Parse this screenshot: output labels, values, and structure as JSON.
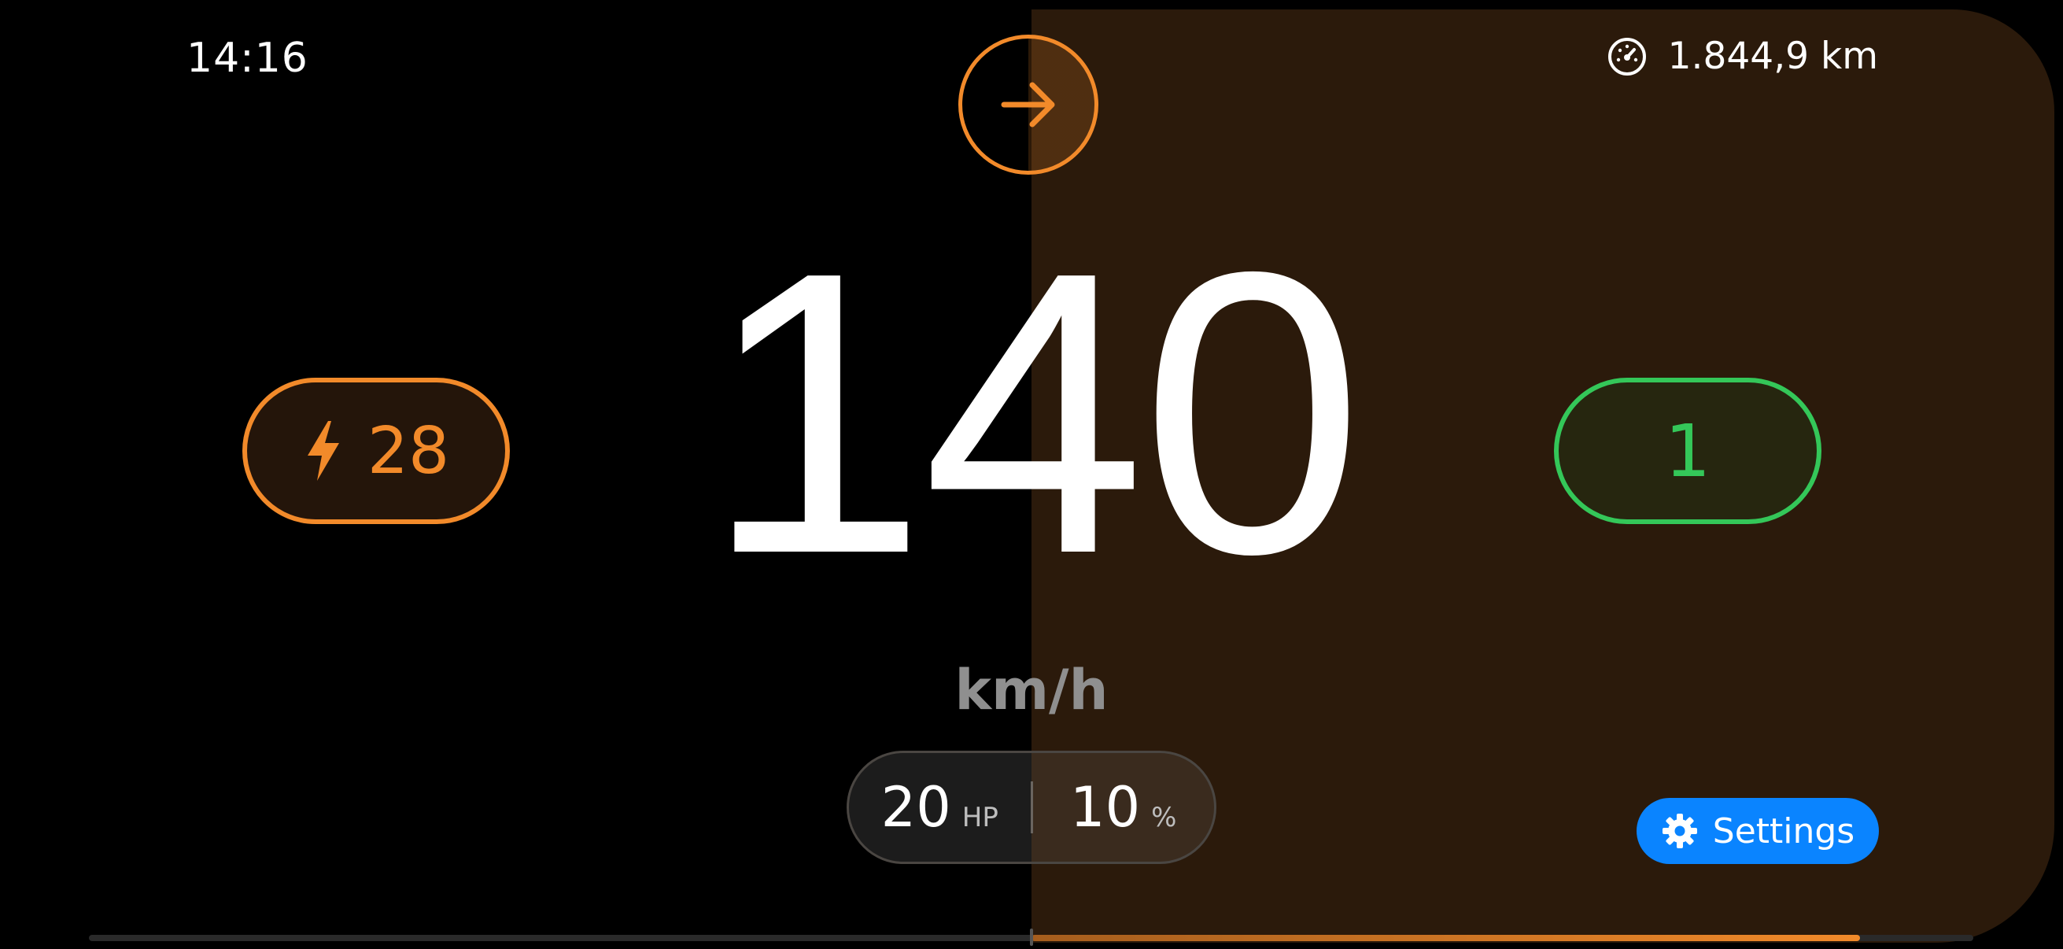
{
  "status": {
    "time": "14:16",
    "odometer": "1.844,9 km",
    "odometer_icon": "speedometer-icon"
  },
  "direction": {
    "icon": "arrow-right-icon",
    "color": "#f28a2a"
  },
  "speed": {
    "value": "140",
    "unit": "km/h"
  },
  "power": {
    "icon": "bolt-icon",
    "value": "28",
    "color": "#f28a2a"
  },
  "gear": {
    "value": "1",
    "color": "#34c759"
  },
  "stats": {
    "hp_value": "20",
    "hp_unit": "HP",
    "percent_value": "10",
    "percent_unit": "%"
  },
  "settings": {
    "label": "Settings",
    "icon": "gear-icon",
    "color": "#0a84ff"
  },
  "throttle_bar": {
    "center_fraction": 0.5,
    "fill_start_fraction": 0.5,
    "fill_end_fraction": 0.94
  }
}
